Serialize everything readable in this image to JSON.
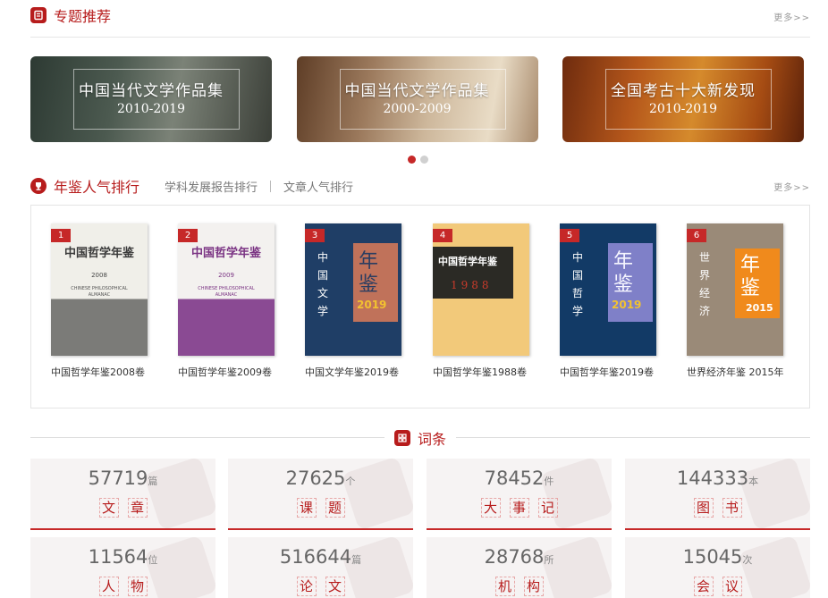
{
  "featured": {
    "title": "专题推荐",
    "more": "更多>>",
    "banners": [
      {
        "title": "中国当代文学作品集",
        "years": "2010-2019"
      },
      {
        "title": "中国当代文学作品集",
        "years": "2000-2009"
      },
      {
        "title": "全国考古十大新发现",
        "years": "2010-2019"
      }
    ],
    "carousel_pages": 2,
    "carousel_active": 1
  },
  "ranking": {
    "title": "年鉴人气排行",
    "tabs": [
      "学科发展报告排行",
      "文章人气排行"
    ],
    "more": "更多>>",
    "books": [
      {
        "rank": "1",
        "title": "中国哲学年鉴2008卷",
        "cover_title": "中国哲学年鉴",
        "cover_year": "2008",
        "cover_en": "CHINESE PHILOSOPHICAL ALMANAC"
      },
      {
        "rank": "2",
        "title": "中国哲学年鉴2009卷",
        "cover_title": "中国哲学年鉴",
        "cover_year": "2009",
        "cover_en": "CHINESE PHILOSOPHICAL ALMANAC"
      },
      {
        "rank": "3",
        "title": "中国文学年鉴2019卷",
        "cover_title": "中国文学",
        "cover_big": "年鉴",
        "cover_year": "2019"
      },
      {
        "rank": "4",
        "title": "中国哲学年鉴1988卷",
        "cover_title": "中国哲学年鉴",
        "cover_year": "1988"
      },
      {
        "rank": "5",
        "title": "中国哲学年鉴2019卷",
        "cover_title": "中国哲学",
        "cover_big": "年鉴",
        "cover_year": "2019"
      },
      {
        "rank": "6",
        "title": "世界经济年鉴 2015年",
        "cover_title": "世界经济",
        "cover_big": "年鉴",
        "cover_year": "2015"
      }
    ]
  },
  "entries": {
    "title": "词条",
    "stats": [
      {
        "number": "57719",
        "unit": "篇",
        "label": [
          "文",
          "章"
        ]
      },
      {
        "number": "27625",
        "unit": "个",
        "label": [
          "课",
          "题"
        ]
      },
      {
        "number": "78452",
        "unit": "件",
        "label": [
          "大",
          "事",
          "记"
        ]
      },
      {
        "number": "144333",
        "unit": "本",
        "label": [
          "图",
          "书"
        ]
      },
      {
        "number": "11564",
        "unit": "位",
        "label": [
          "人",
          "物"
        ]
      },
      {
        "number": "516644",
        "unit": "篇",
        "label": [
          "论",
          "文"
        ]
      },
      {
        "number": "28768",
        "unit": "所",
        "label": [
          "机",
          "构"
        ]
      },
      {
        "number": "15045",
        "unit": "次",
        "label": [
          "会",
          "议"
        ]
      }
    ]
  },
  "colors": {
    "accent": "#c62828",
    "brand_dark": "#b71c1c"
  }
}
